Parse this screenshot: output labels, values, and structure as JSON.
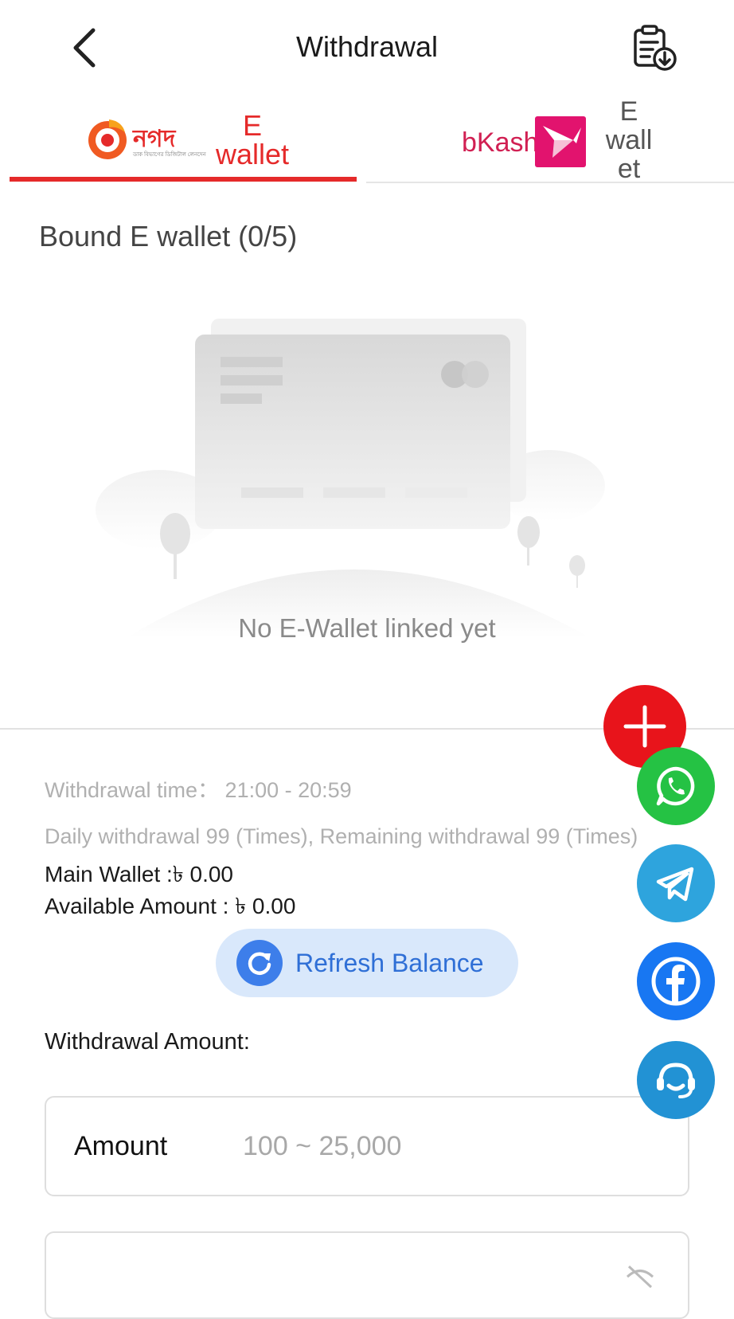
{
  "header": {
    "title": "Withdrawal",
    "back_icon": "chevron-left-icon",
    "records_icon": "clipboard-download-icon"
  },
  "tabs": [
    {
      "logo": "নগদ",
      "logo_sub": "ডাক বিভাগের ডিজিটাল লেনদেন",
      "label_lines": [
        "E",
        "wallet"
      ],
      "active": true
    },
    {
      "logo": "bKash",
      "label_lines": [
        "E",
        "wall",
        "et"
      ],
      "active": false
    }
  ],
  "bound": {
    "title": "Bound E wallet (0/5)",
    "empty_text": "No E-Wallet linked yet"
  },
  "info": {
    "withdrawal_time": "Withdrawal time：  21:00 - 20:59",
    "daily": "Daily withdrawal 99 (Times), Remaining withdrawal 99 (Times)",
    "main_wallet": "Main Wallet :৳ 0.00",
    "available": "Available Amount : ৳ 0.00"
  },
  "refresh": {
    "label": "Refresh Balance"
  },
  "amount": {
    "section_label": "Withdrawal Amount:",
    "field_label": "Amount",
    "placeholder": "100 ~ 25,000"
  },
  "colors": {
    "accent_red": "#e52a2a",
    "whatsapp": "#25c244",
    "telegram": "#2ea4dd",
    "facebook": "#1877f2",
    "support": "#2292d4"
  }
}
